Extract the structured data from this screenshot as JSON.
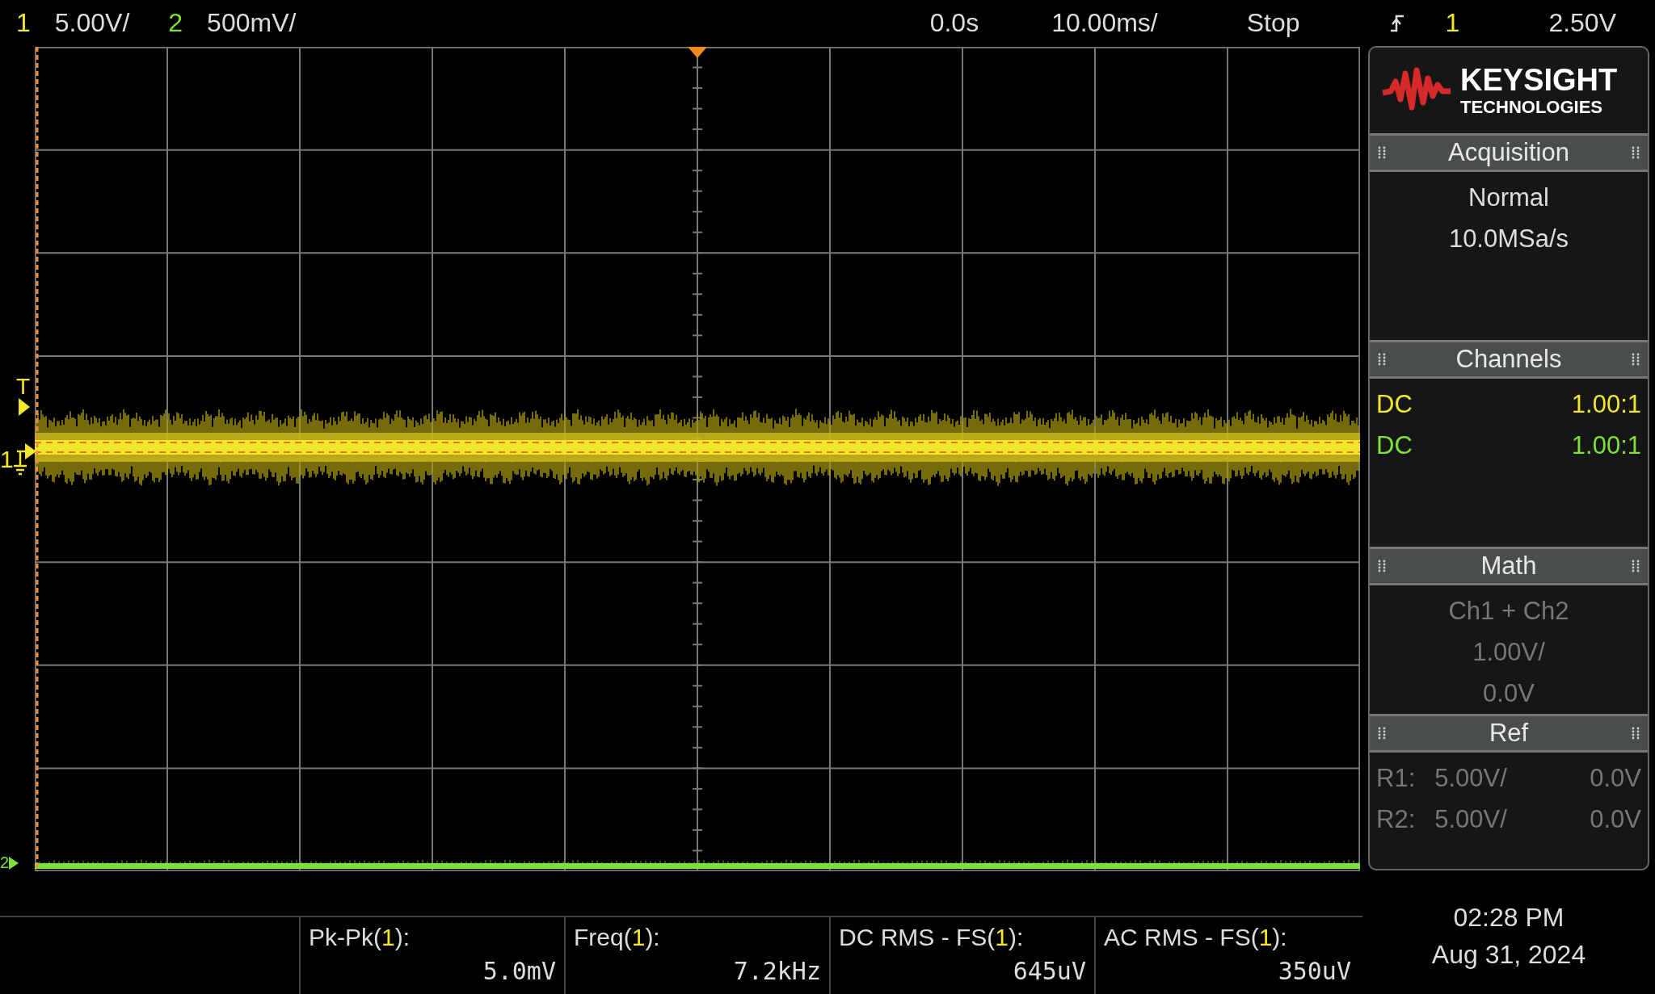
{
  "top_bar": {
    "channels": [
      {
        "number": "1",
        "scale": "5.00V/",
        "color": "#f2e62c"
      },
      {
        "number": "2",
        "scale": "500mV/",
        "color": "#7fe03a"
      }
    ],
    "delay": "0.0s",
    "timebase": "10.00ms/",
    "run_state": "Stop",
    "trigger": {
      "source": "1",
      "level": "2.50V"
    }
  },
  "graticule": {
    "markers": [
      {
        "label": "T",
        "kind": "trigger"
      },
      {
        "label": "1",
        "kind": "ground"
      },
      {
        "label": "2",
        "kind": "channel"
      }
    ]
  },
  "sidebar": {
    "logo": {
      "name": "KEYSIGHT",
      "subtitle": "TECHNOLOGIES"
    },
    "sections": [
      {
        "title": "Acquisition",
        "kind": "lines",
        "disabled": false,
        "lines": [
          "Normal",
          "10.0MSa/s"
        ]
      },
      {
        "title": "Channels",
        "kind": "channels",
        "disabled": false,
        "channels": [
          {
            "coupling": "DC",
            "probe": "1.00:1"
          },
          {
            "coupling": "DC",
            "probe": "1.00:1"
          }
        ]
      },
      {
        "title": "Math",
        "kind": "lines",
        "disabled": true,
        "lines": [
          "Ch1 + Ch2",
          "1.00V/",
          "0.0V"
        ]
      },
      {
        "title": "Ref",
        "kind": "refs",
        "disabled": true,
        "refs": [
          {
            "name": "R1:",
            "scale": "5.00V/",
            "offset": "0.0V"
          },
          {
            "name": "R2:",
            "scale": "5.00V/",
            "offset": "0.0V"
          }
        ]
      }
    ]
  },
  "measurements": [
    {
      "name": "Pk-Pk(",
      "source": "1",
      "suffix": "):",
      "value": "5.0mV"
    },
    {
      "name": "Freq(",
      "source": "1",
      "suffix": "):",
      "value": "7.2kHz"
    },
    {
      "name": "DC RMS - FS(",
      "source": "1",
      "suffix": "):",
      "value": "645uV"
    },
    {
      "name": "AC RMS - FS(",
      "source": "1",
      "suffix": "):",
      "value": "350uV"
    }
  ],
  "clock": {
    "time": "02:28 PM",
    "date": "Aug 31, 2024"
  }
}
